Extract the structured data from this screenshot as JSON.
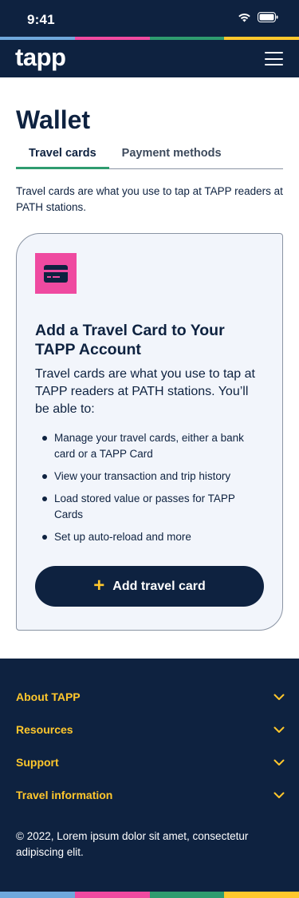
{
  "status_bar": {
    "time": "9:41"
  },
  "brand_stripe_colors": [
    "#6fa8dc",
    "#ef4aa0",
    "#2e9c6f",
    "#ffc72c"
  ],
  "header": {
    "logo": "tapp",
    "menu_icon": "hamburger-menu-icon"
  },
  "page": {
    "title": "Wallet",
    "tabs": [
      {
        "label": "Travel cards",
        "active": true
      },
      {
        "label": "Payment methods",
        "active": false
      }
    ],
    "intro": "Travel cards are what you use to tap at TAPP readers at PATH stations."
  },
  "card": {
    "icon": "credit-card-icon",
    "title": "Add a Travel Card to Your TAPP Account",
    "description": "Travel cards are what you use to tap at TAPP readers at PATH stations. You’ll be able to:",
    "bullets": [
      "Manage your travel cards, either a bank card or a TAPP Card",
      "View your transaction and trip history",
      "Load stored value or passes for TAPP Cards",
      "Set up auto-reload and more"
    ],
    "button_icon": "plus-icon",
    "button_label": "Add travel card"
  },
  "footer": {
    "sections": [
      {
        "label": "About TAPP"
      },
      {
        "label": "Resources"
      },
      {
        "label": "Support"
      },
      {
        "label": "Travel information"
      }
    ],
    "copyright": "© 2022, Lorem ipsum dolor sit amet, consectetur adipiscing elit."
  },
  "colors": {
    "navy": "#0e2240",
    "accent_yellow": "#ffc72c",
    "accent_pink": "#ef4aa0",
    "accent_green": "#2e9c6f",
    "accent_blue": "#6fa8dc",
    "card_bg": "#f2f5fb"
  }
}
